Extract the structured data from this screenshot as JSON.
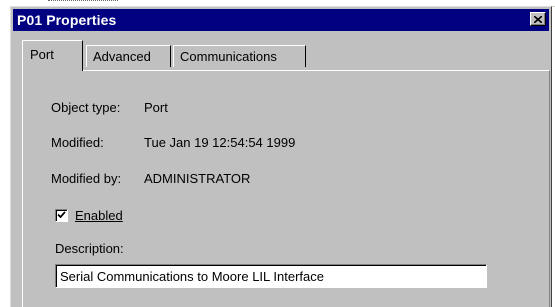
{
  "window": {
    "title": "P01 Properties"
  },
  "tabs": [
    {
      "label": "Port",
      "active": true
    },
    {
      "label": "Advanced",
      "active": false
    },
    {
      "label": "Communications",
      "active": false
    }
  ],
  "fields": {
    "object_type": {
      "label": "Object type:",
      "value": "Port"
    },
    "modified": {
      "label": "Modified:",
      "value": "Tue Jan 19 12:54:54 1999"
    },
    "modified_by": {
      "label": "Modified by:",
      "value": "ADMINISTRATOR"
    }
  },
  "enabled": {
    "label": "Enabled",
    "checked": true
  },
  "description": {
    "label": "Description:",
    "value": "Serial Communications to Moore LIL Interface"
  },
  "colors": {
    "titlebar": "#000080",
    "face": "#c0c0c0"
  },
  "icons": {
    "close": "close-icon",
    "check": "checkmark-icon"
  }
}
